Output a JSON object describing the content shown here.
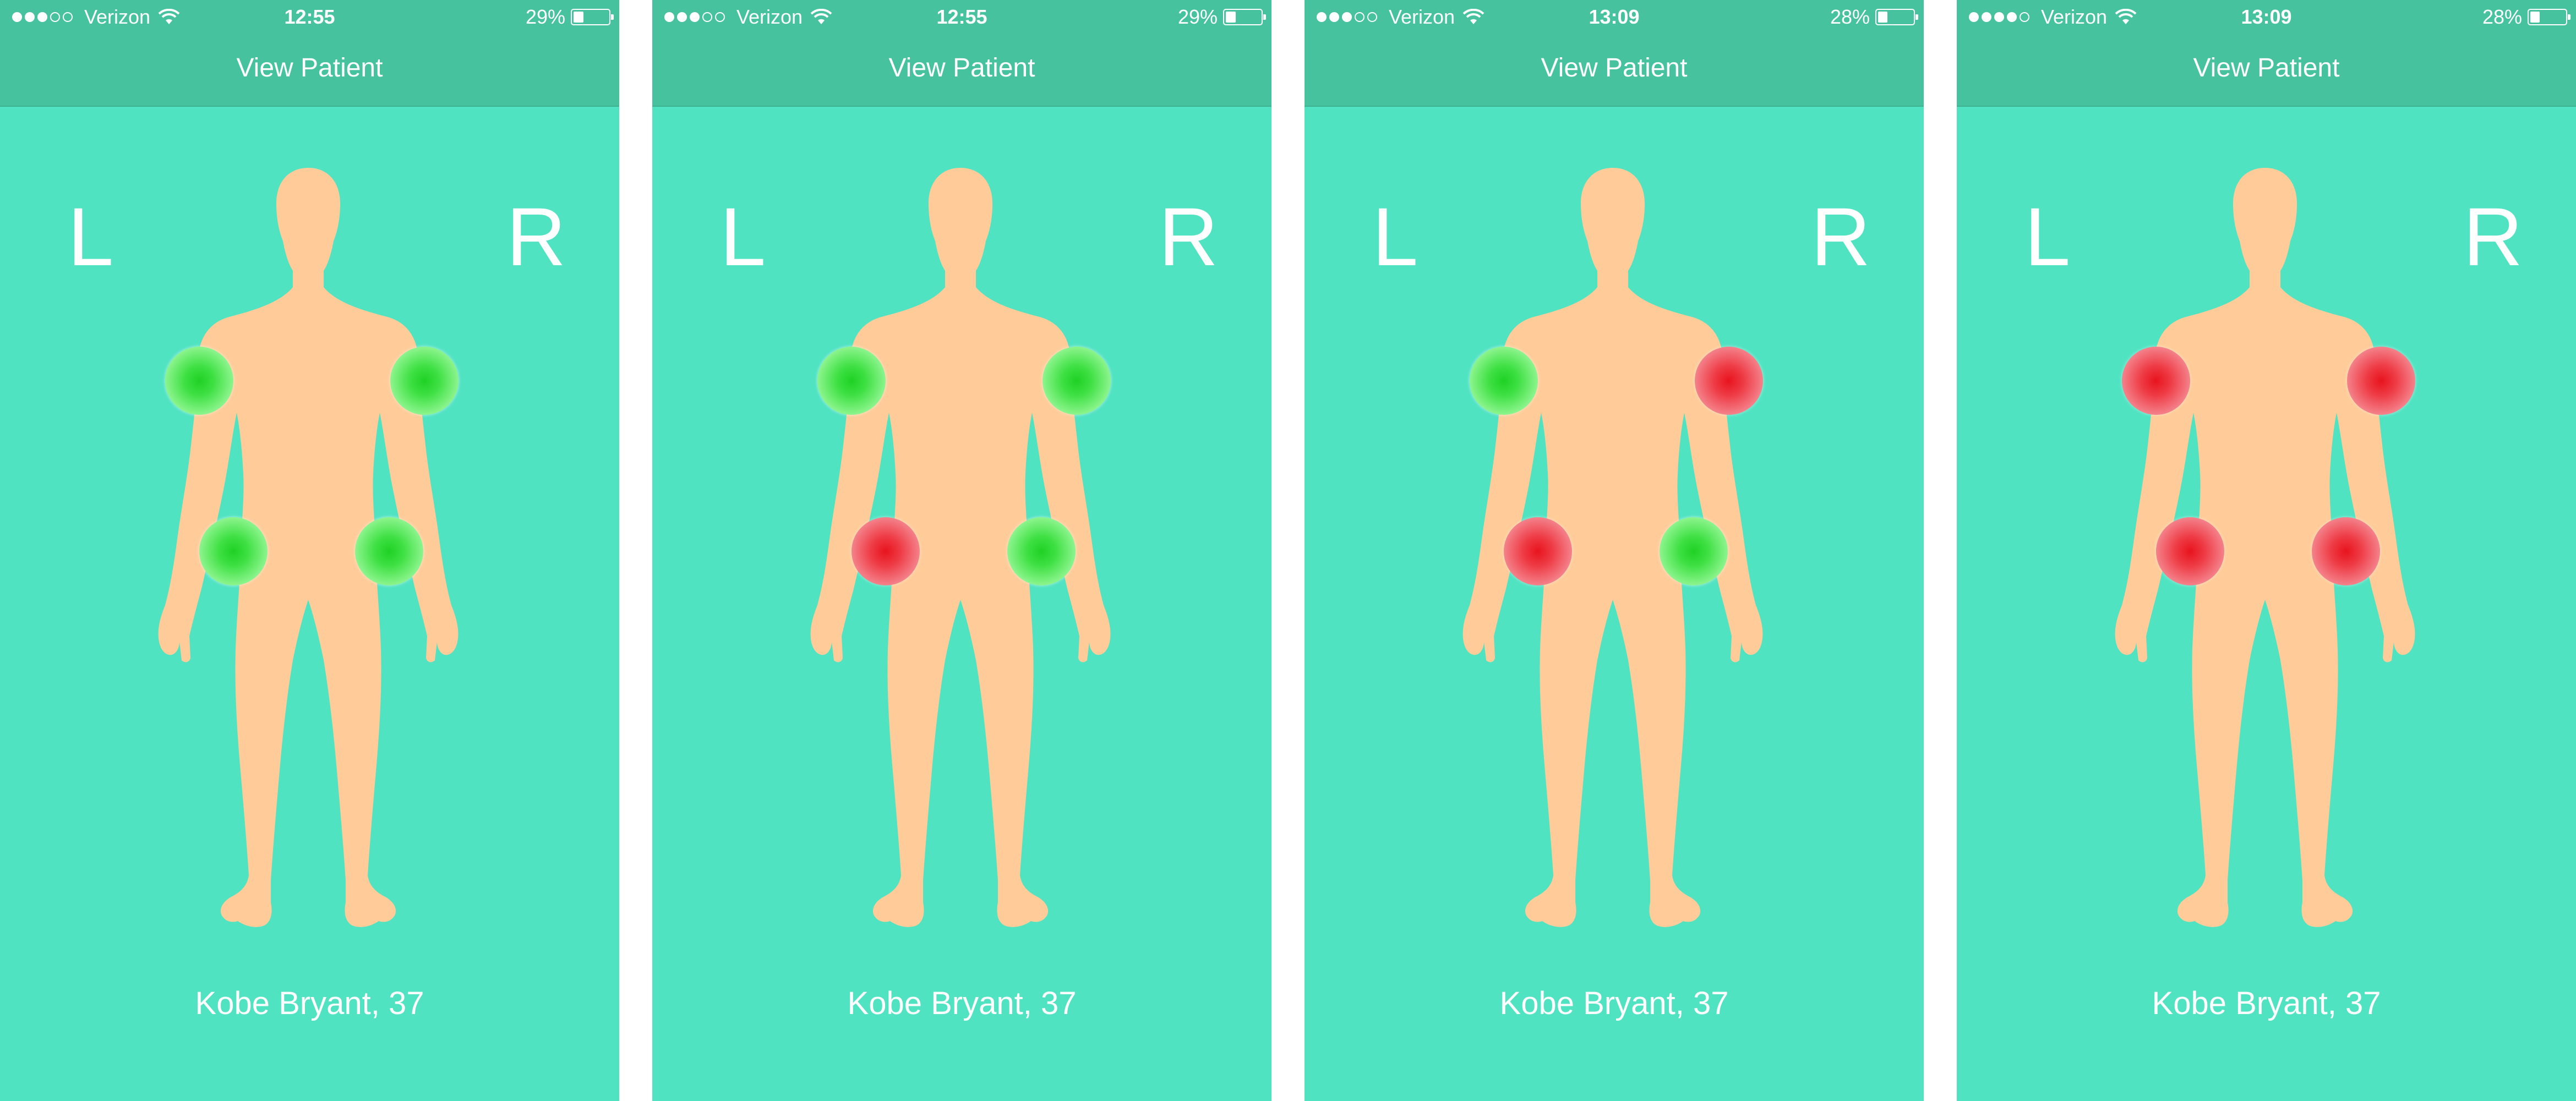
{
  "colors": {
    "screen_background": "#50e3c2",
    "bar_background": "#46c29f",
    "body_silhouette": "#ffcc99",
    "joint_ok": "#22d126",
    "joint_alert": "#e8141e"
  },
  "screens": [
    {
      "status": {
        "carrier": "Verizon",
        "signal_bars": 3,
        "signal_total": 5,
        "time": "12:55",
        "battery_text": "29%",
        "battery_level": 0.29
      },
      "nav": {
        "title": "View Patient"
      },
      "sides": {
        "left": "L",
        "right": "R"
      },
      "joints": {
        "left_shoulder": "green",
        "right_shoulder": "green",
        "left_hip": "green",
        "right_hip": "green"
      },
      "patient": {
        "label": "Kobe Bryant, 37"
      }
    },
    {
      "status": {
        "carrier": "Verizon",
        "signal_bars": 3,
        "signal_total": 5,
        "time": "12:55",
        "battery_text": "29%",
        "battery_level": 0.29
      },
      "nav": {
        "title": "View Patient"
      },
      "sides": {
        "left": "L",
        "right": "R"
      },
      "joints": {
        "left_shoulder": "green",
        "right_shoulder": "green",
        "left_hip": "red",
        "right_hip": "green"
      },
      "patient": {
        "label": "Kobe Bryant, 37"
      }
    },
    {
      "status": {
        "carrier": "Verizon",
        "signal_bars": 3,
        "signal_total": 5,
        "time": "13:09",
        "battery_text": "28%",
        "battery_level": 0.28
      },
      "nav": {
        "title": "View Patient"
      },
      "sides": {
        "left": "L",
        "right": "R"
      },
      "joints": {
        "left_shoulder": "green",
        "right_shoulder": "red",
        "left_hip": "red",
        "right_hip": "green"
      },
      "patient": {
        "label": "Kobe Bryant, 37"
      }
    },
    {
      "status": {
        "carrier": "Verizon",
        "signal_bars": 4,
        "signal_total": 5,
        "time": "13:09",
        "battery_text": "28%",
        "battery_level": 0.28
      },
      "nav": {
        "title": "View Patient"
      },
      "sides": {
        "left": "L",
        "right": "R"
      },
      "joints": {
        "left_shoulder": "red",
        "right_shoulder": "red",
        "left_hip": "red",
        "right_hip": "red"
      },
      "patient": {
        "label": "Kobe Bryant, 37"
      }
    }
  ]
}
